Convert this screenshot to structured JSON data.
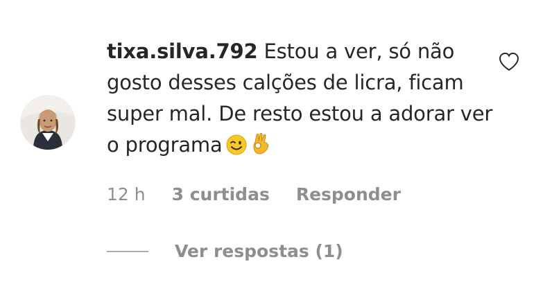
{
  "comment": {
    "username": "tixa.silva.792",
    "text": "Estou a ver, só não gosto desses calções de licra, ficam super mal. De resto estou a adorar ver o programa",
    "emojis": [
      "winking-face-emoji",
      "ok-hand-emoji"
    ],
    "time": "12 h",
    "likes": "3 curtidas",
    "reply_label": "Responder",
    "view_replies_label": "Ver respostas (1)"
  },
  "icons": {
    "like": "heart-outline-icon",
    "avatar": "user-avatar"
  },
  "colors": {
    "text": "#262626",
    "secondary": "#8e8e8e",
    "background": "#ffffff"
  }
}
